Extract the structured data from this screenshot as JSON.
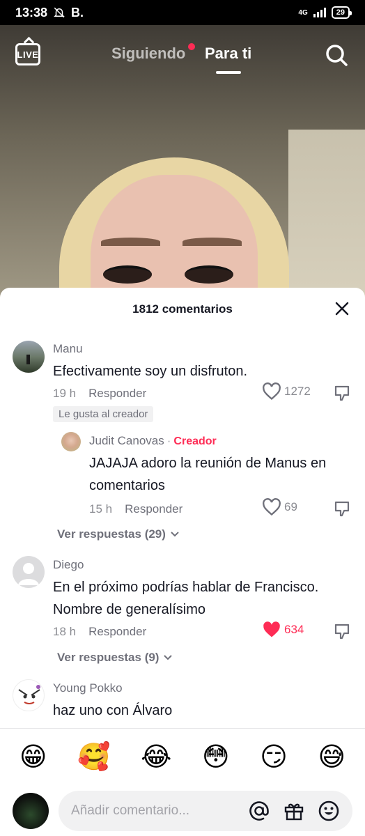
{
  "status_bar": {
    "time": "13:38",
    "carrier_letter": "B.",
    "network": "4G",
    "battery": "29"
  },
  "top_nav": {
    "live_label": "LIVE",
    "tab_following": "Siguiendo",
    "tab_for_you": "Para ti"
  },
  "comments_sheet": {
    "title": "1812 comentarios",
    "comments": [
      {
        "username": "Manu",
        "text": "Efectivamente soy un disfruton.",
        "time": "19 h",
        "reply_label": "Responder",
        "likes": "1272",
        "liked": false,
        "creator_liked_label": "Le gusta al creador",
        "reply": {
          "username": "Judit Canovas",
          "creator_tag": "Creador",
          "text_line1": "JAJAJA adoro la reunión de Manus en",
          "text_line2": "comentarios",
          "time": "15 h",
          "reply_label": "Responder",
          "likes": "69"
        },
        "view_replies": "Ver respuestas (29)"
      },
      {
        "username": "Diego",
        "text_line1": "En el próximo podrías hablar de Francisco.",
        "text_line2": "Nombre de generalísimo",
        "time": "18 h",
        "reply_label": "Responder",
        "likes": "634",
        "liked": true,
        "view_replies": "Ver respuestas (9)"
      },
      {
        "username": "Young Pokko",
        "text": "haz uno con Álvaro"
      }
    ]
  },
  "emoji_bar": [
    "😁",
    "🥰",
    "😂",
    "😳",
    "😏",
    "😅"
  ],
  "comment_input": {
    "placeholder": "Añadir comentario..."
  },
  "colors": {
    "accent": "#fe2c55",
    "sheet_bg": "#ffffff",
    "muted_text": "#8a8b91"
  }
}
